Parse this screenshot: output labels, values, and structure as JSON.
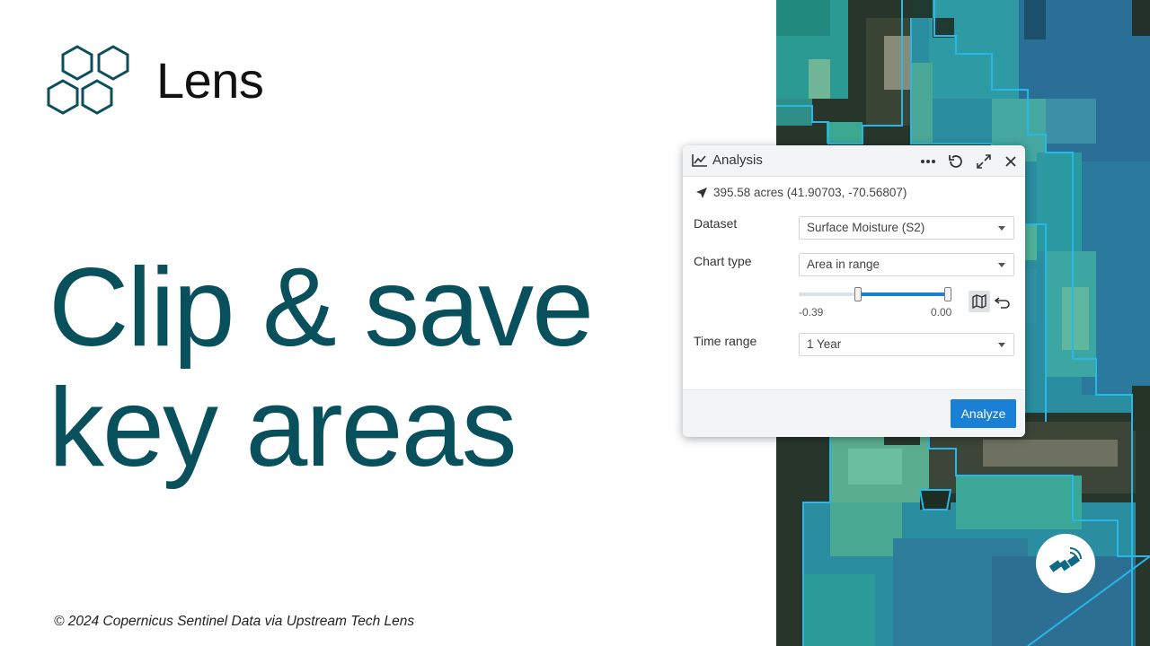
{
  "brand": {
    "name": "Lens",
    "logo_icon": "hexagon-cluster-logo"
  },
  "headline": {
    "line1": "Clip & save",
    "line2": "key areas"
  },
  "credit": "© 2024 Copernicus Sentinel Data via Upstream Tech Lens",
  "colors": {
    "headline": "#07505c",
    "accent": "#1a80d6",
    "logo": "#0c4f5b"
  },
  "panel": {
    "title": "Analysis",
    "title_icon": "line-chart-icon",
    "header_actions": [
      "more-options-icon",
      "refresh-icon",
      "expand-icon",
      "close-icon"
    ],
    "location": "395.58 acres (41.90703, -70.56807)",
    "dataset_label": "Dataset",
    "dataset_value": "Surface Moisture (S2)",
    "chart_type_label": "Chart type",
    "chart_type_value": "Area in range",
    "range_min": "-0.39",
    "range_max": "0.00",
    "range_fill_start": 0.38,
    "range_fill_end": 1.0,
    "time_range_label": "Time range",
    "time_range_value": "1 Year",
    "analyze_label": "Analyze"
  },
  "map": {
    "badge_icon": "satellite-icon"
  }
}
